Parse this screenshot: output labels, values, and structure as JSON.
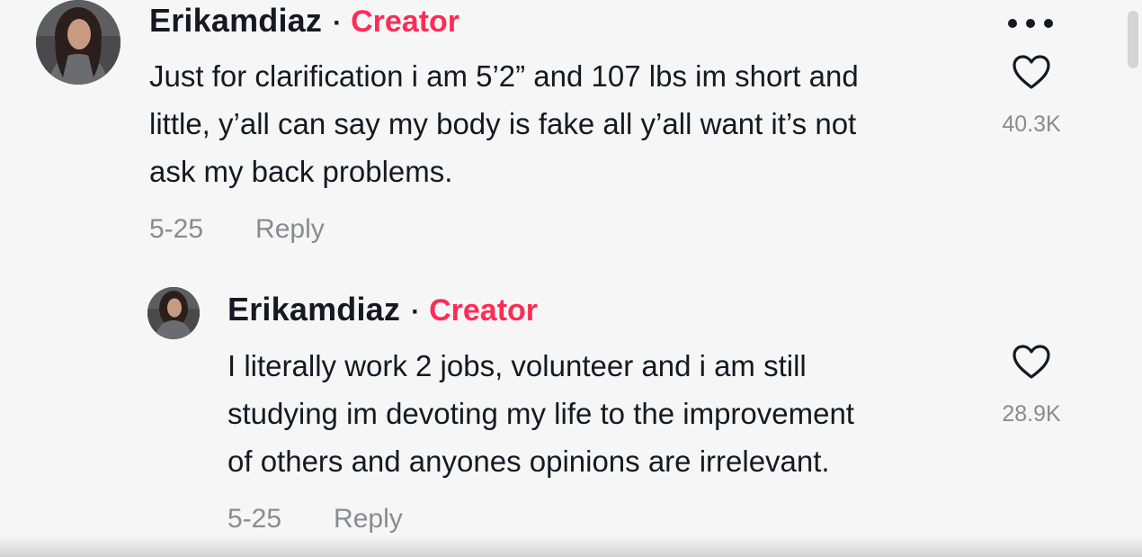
{
  "comment": {
    "username": "Erikamdiaz",
    "separator": "·",
    "badge": "Creator",
    "text_lines": [
      "Just for clarification i am 5’2” and 107 lbs im short and",
      "little, y’all can say my body is fake all y’all want it’s not",
      "ask my back problems."
    ],
    "date": "5-25",
    "reply_label": "Reply",
    "like_count": "40.3K",
    "more_icon": "more-horizontal-icon",
    "like_icon": "heart-outline-icon"
  },
  "reply": {
    "username": "Erikamdiaz",
    "separator": "·",
    "badge": "Creator",
    "text_lines": [
      "I literally work 2 jobs, volunteer and i am still",
      "studying im devoting my life to the improvement",
      "of others and anyones opinions are irrelevant."
    ],
    "date": "5-25",
    "reply_label": "Reply",
    "like_count": "28.9K",
    "like_icon": "heart-outline-icon"
  },
  "colors": {
    "background": "#f6f6f6",
    "text": "#161823",
    "creator_badge": "#fe2c55",
    "muted": "#8a8b91"
  }
}
